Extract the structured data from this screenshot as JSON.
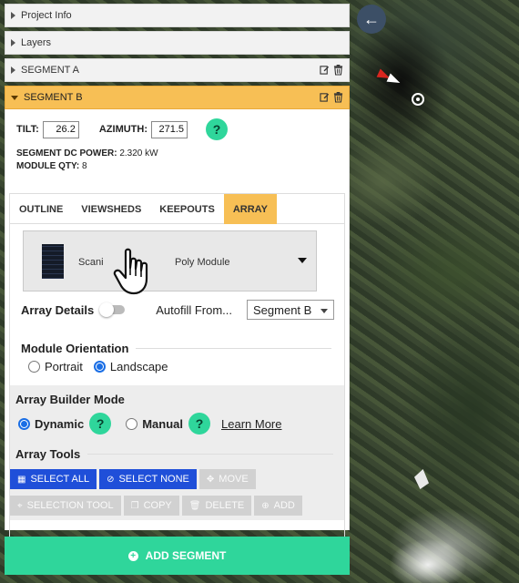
{
  "accordion": {
    "project_info": "Project Info",
    "layers": "Layers",
    "segment_a": "SEGMENT A",
    "segment_b": "SEGMENT B"
  },
  "segment": {
    "tilt_label": "TILT:",
    "tilt_value": "26.2",
    "azimuth_label": "AZIMUTH:",
    "azimuth_value": "271.5",
    "help": "?",
    "dc_power_label": "SEGMENT DC POWER:",
    "dc_power_value": "2.320 kW",
    "module_qty_label": "MODULE QTY:",
    "module_qty_value": "8"
  },
  "tabs": [
    {
      "label": "OUTLINE"
    },
    {
      "label": "VIEWSHEDS"
    },
    {
      "label": "KEEPOUTS"
    },
    {
      "label": "ARRAY",
      "active": true
    }
  ],
  "module": {
    "name_visible_left": "Scani",
    "name_visible_right": "Poly Module"
  },
  "array_details": {
    "label": "Array Details",
    "toggle_on": false,
    "autofill_label": "Autofill From...",
    "autofill_value": "Segment B"
  },
  "orientation": {
    "title": "Module Orientation",
    "portrait": "Portrait",
    "landscape": "Landscape",
    "selected": "Landscape"
  },
  "builder": {
    "title": "Array Builder Mode",
    "dynamic": "Dynamic",
    "manual": "Manual",
    "learn_more": "Learn More",
    "selected": "Dynamic"
  },
  "tools": {
    "title": "Array Tools",
    "select_all": "SELECT ALL",
    "select_none": "SELECT NONE",
    "move": "MOVE",
    "selection_tool": "SELECTION TOOL",
    "copy": "COPY",
    "delete": "DELETE",
    "add": "ADD"
  },
  "add_segment": "ADD SEGMENT",
  "colors": {
    "accent_orange": "#f7bf55",
    "accent_green": "#2fd69b",
    "button_blue": "#1f4fd9",
    "map_button": "#3c4f66"
  }
}
